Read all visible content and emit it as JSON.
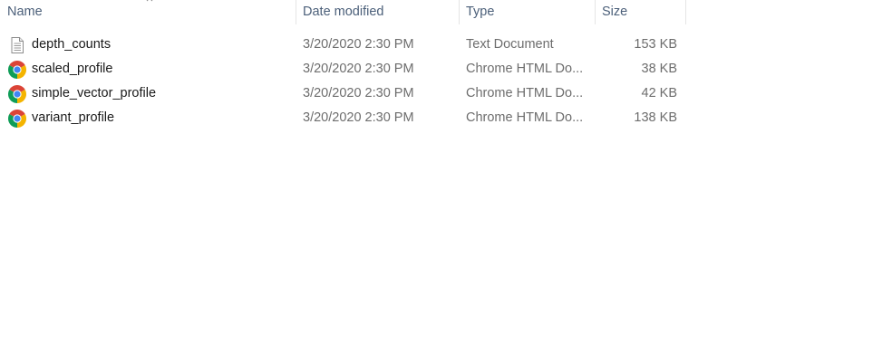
{
  "columns": {
    "name": "Name",
    "date_modified": "Date modified",
    "type": "Type",
    "size": "Size"
  },
  "files": [
    {
      "name": "depth_counts",
      "date": "3/20/2020 2:30 PM",
      "type": "Text Document",
      "size": "153 KB",
      "icon": "text-document-icon"
    },
    {
      "name": "scaled_profile",
      "date": "3/20/2020 2:30 PM",
      "type": "Chrome HTML Do...",
      "size": "38 KB",
      "icon": "chrome-icon"
    },
    {
      "name": "simple_vector_profile",
      "date": "3/20/2020 2:30 PM",
      "type": "Chrome HTML Do...",
      "size": "42 KB",
      "icon": "chrome-icon"
    },
    {
      "name": "variant_profile",
      "date": "3/20/2020 2:30 PM",
      "type": "Chrome HTML Do...",
      "size": "138 KB",
      "icon": "chrome-icon"
    }
  ],
  "colors": {
    "header_text": "#4c607a",
    "secondary_text": "#6d6d6d",
    "primary_text": "#1a1a1a"
  }
}
